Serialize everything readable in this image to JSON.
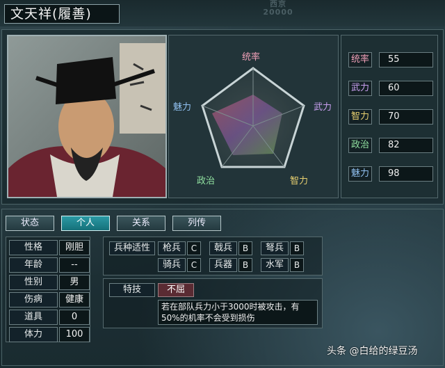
{
  "header": {
    "title": "文天祥(履善)",
    "top_right_text": "20000",
    "top_right_label": "西京"
  },
  "radar": {
    "labels": {
      "top": "统率",
      "right": "武力",
      "bottom_right": "智力",
      "bottom_left": "政治",
      "left": "魅力"
    },
    "label_colors": {
      "top": "#f0a0b8",
      "right": "#c9a0f0",
      "bottom_right": "#e8d070",
      "bottom_left": "#90e0a0",
      "left": "#90c0f0"
    }
  },
  "stats": [
    {
      "name": "统率",
      "value": "55",
      "color": "#f0a0b8"
    },
    {
      "name": "武力",
      "value": "60",
      "color": "#c9a0f0"
    },
    {
      "name": "智力",
      "value": "70",
      "color": "#e8d070"
    },
    {
      "name": "政治",
      "value": "82",
      "color": "#90e0a0"
    },
    {
      "name": "魅力",
      "value": "98",
      "color": "#90c0f0"
    }
  ],
  "tabs": [
    {
      "label": "状态",
      "active": false
    },
    {
      "label": "个人",
      "active": true
    },
    {
      "label": "关系",
      "active": false
    },
    {
      "label": "列传",
      "active": false
    }
  ],
  "info": [
    {
      "label": "性格",
      "value": "刚胆"
    },
    {
      "label": "年龄",
      "value": "--"
    },
    {
      "label": "性别",
      "value": "男"
    },
    {
      "label": "伤病",
      "value": "健康"
    },
    {
      "label": "道具",
      "value": "0"
    },
    {
      "label": "体力",
      "value": "100"
    }
  ],
  "aptitude": {
    "header": "兵种适性",
    "units": [
      {
        "name": "枪兵",
        "grade": "C"
      },
      {
        "name": "戟兵",
        "grade": "B"
      },
      {
        "name": "弩兵",
        "grade": "B"
      },
      {
        "name": "骑兵",
        "grade": "C"
      },
      {
        "name": "兵器",
        "grade": "B"
      },
      {
        "name": "水军",
        "grade": "B"
      }
    ]
  },
  "skill": {
    "label": "特技",
    "name": "不屈",
    "description": "若在部队兵力小于3000时被攻击，有50%的机率不会受到损伤"
  },
  "watermark": "头条 @白给的绿豆汤"
}
